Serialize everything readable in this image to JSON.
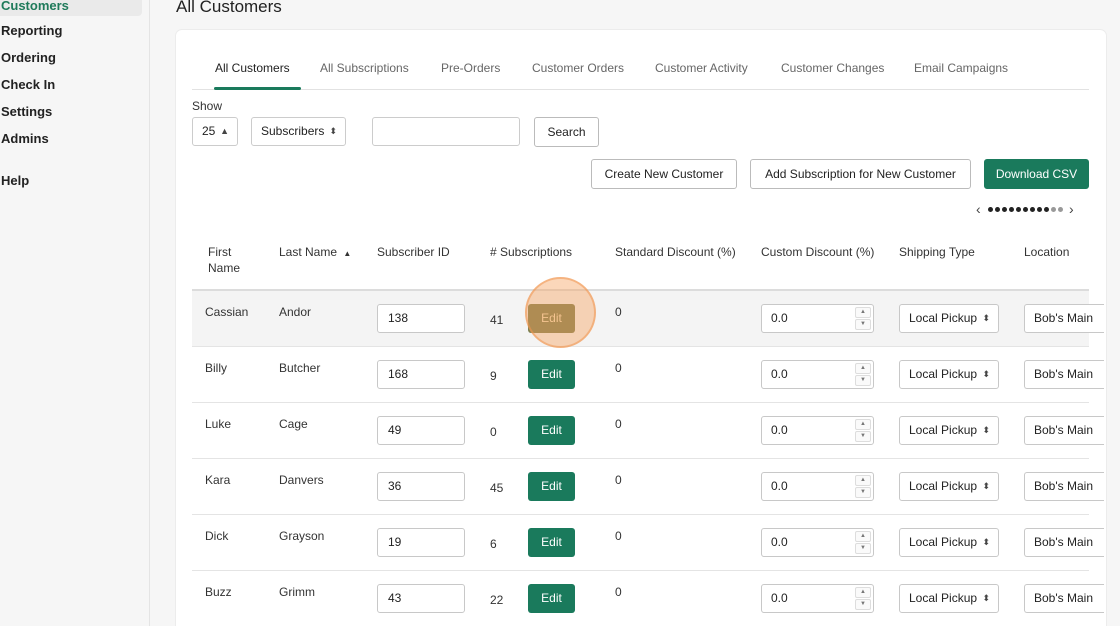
{
  "sidebar": {
    "items": [
      {
        "label": "Customers",
        "active": true
      },
      {
        "label": "Reporting"
      },
      {
        "label": "Ordering"
      },
      {
        "label": "Check In"
      },
      {
        "label": "Settings"
      },
      {
        "label": "Admins"
      },
      {
        "label": "Help"
      }
    ]
  },
  "page": {
    "title": "All Customers"
  },
  "tabs": [
    {
      "label": "All Customers",
      "active": true
    },
    {
      "label": "All Subscriptions"
    },
    {
      "label": "Pre-Orders"
    },
    {
      "label": "Customer Orders"
    },
    {
      "label": "Customer Activity"
    },
    {
      "label": "Customer Changes"
    },
    {
      "label": "Email Campaigns"
    }
  ],
  "controls": {
    "show_label": "Show",
    "page_size": "25",
    "filter": "Subscribers",
    "search_value": "",
    "search_button": "Search",
    "create_button": "Create New Customer",
    "add_sub_button": "Add Subscription for New Customer",
    "download_button": "Download CSV"
  },
  "table": {
    "headers": {
      "first_name": "First Name",
      "last_name": "Last Name",
      "sort_indicator": "▲",
      "subscriber_id": "Subscriber ID",
      "subscriptions": "# Subscriptions",
      "standard_discount": "Standard Discount (%)",
      "custom_discount": "Custom Discount (%)",
      "shipping_type": "Shipping Type",
      "location": "Location"
    },
    "edit_label": "Edit",
    "rows": [
      {
        "first": "Cassian",
        "last": "Andor",
        "id": "138",
        "subs": "41",
        "std": "0",
        "custom": "0.0",
        "ship": "Local Pickup",
        "location": "Bob's Main"
      },
      {
        "first": "Billy",
        "last": "Butcher",
        "id": "168",
        "subs": "9",
        "std": "0",
        "custom": "0.0",
        "ship": "Local Pickup",
        "location": "Bob's Main"
      },
      {
        "first": "Luke",
        "last": "Cage",
        "id": "49",
        "subs": "0",
        "std": "0",
        "custom": "0.0",
        "ship": "Local Pickup",
        "location": "Bob's Main"
      },
      {
        "first": "Kara",
        "last": "Danvers",
        "id": "36",
        "subs": "45",
        "std": "0",
        "custom": "0.0",
        "ship": "Local Pickup",
        "location": "Bob's Main"
      },
      {
        "first": "Dick",
        "last": "Grayson",
        "id": "19",
        "subs": "6",
        "std": "0",
        "custom": "0.0",
        "ship": "Local Pickup",
        "location": "Bob's Main"
      },
      {
        "first": "Buzz",
        "last": "Grimm",
        "id": "43",
        "subs": "22",
        "std": "0",
        "custom": "0.0",
        "ship": "Local Pickup",
        "location": "Bob's Main"
      }
    ]
  },
  "colors": {
    "primary": "#1a7a5c",
    "highlight": "#f5a05a"
  },
  "icons": {
    "caret": "updown-caret-icon",
    "prev": "chevron-left-icon",
    "next": "chevron-right-icon"
  }
}
